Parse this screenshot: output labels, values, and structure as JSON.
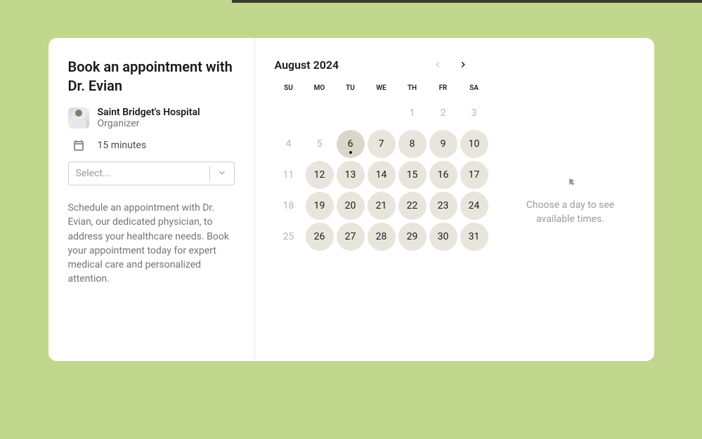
{
  "left": {
    "title": "Book an appointment with Dr. Evian",
    "organizer_name": "Saint Bridget's Hospital",
    "organizer_role": "Organizer",
    "duration": "15 minutes",
    "select_placeholder": "Select...",
    "description": "Schedule an appointment with Dr. Evian, our dedicated physician, to address your healthcare needs. Book your appointment today for expert medical care and personalized attention."
  },
  "calendar": {
    "month_year": "August 2024",
    "day_headers": [
      "SU",
      "MO",
      "TU",
      "WE",
      "TH",
      "FR",
      "SA"
    ],
    "weeks": [
      [
        {
          "day": "",
          "state": "blank"
        },
        {
          "day": "",
          "state": "blank"
        },
        {
          "day": "",
          "state": "blank"
        },
        {
          "day": "",
          "state": "blank"
        },
        {
          "day": "1",
          "state": "disabled"
        },
        {
          "day": "2",
          "state": "disabled"
        },
        {
          "day": "3",
          "state": "disabled"
        }
      ],
      [
        {
          "day": "4",
          "state": "disabled"
        },
        {
          "day": "5",
          "state": "disabled"
        },
        {
          "day": "6",
          "state": "today"
        },
        {
          "day": "7",
          "state": "enabled"
        },
        {
          "day": "8",
          "state": "enabled"
        },
        {
          "day": "9",
          "state": "enabled"
        },
        {
          "day": "10",
          "state": "enabled"
        }
      ],
      [
        {
          "day": "11",
          "state": "disabled"
        },
        {
          "day": "12",
          "state": "enabled"
        },
        {
          "day": "13",
          "state": "enabled"
        },
        {
          "day": "14",
          "state": "enabled"
        },
        {
          "day": "15",
          "state": "enabled"
        },
        {
          "day": "16",
          "state": "enabled"
        },
        {
          "day": "17",
          "state": "enabled"
        }
      ],
      [
        {
          "day": "18",
          "state": "disabled"
        },
        {
          "day": "19",
          "state": "enabled"
        },
        {
          "day": "20",
          "state": "enabled"
        },
        {
          "day": "21",
          "state": "enabled"
        },
        {
          "day": "22",
          "state": "enabled"
        },
        {
          "day": "23",
          "state": "enabled"
        },
        {
          "day": "24",
          "state": "enabled"
        }
      ],
      [
        {
          "day": "25",
          "state": "disabled"
        },
        {
          "day": "26",
          "state": "enabled"
        },
        {
          "day": "27",
          "state": "enabled"
        },
        {
          "day": "28",
          "state": "enabled"
        },
        {
          "day": "29",
          "state": "enabled"
        },
        {
          "day": "30",
          "state": "enabled"
        },
        {
          "day": "31",
          "state": "enabled"
        }
      ]
    ]
  },
  "right": {
    "choose_text": "Choose a day to see available times."
  }
}
